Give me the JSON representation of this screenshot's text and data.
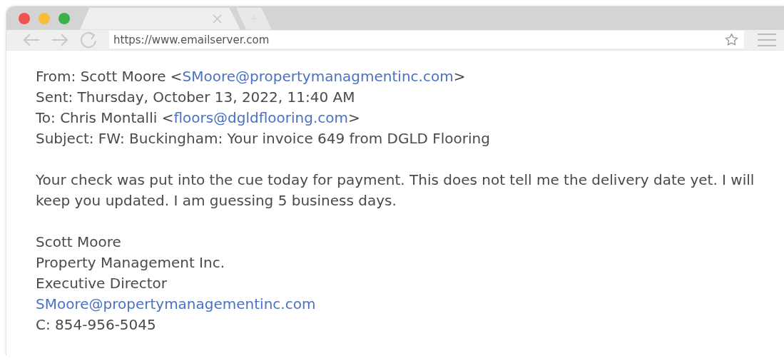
{
  "browser": {
    "tabs": [
      {
        "selected": true
      }
    ],
    "address": {
      "value": "https://www.emailserver.com"
    }
  },
  "email": {
    "header": [
      {
        "label": "From: Scott Moore <",
        "email": "SMoore@propertymanagmentinc.com",
        "after": ">"
      },
      {
        "label": "Sent: Thursday, October 13, 2022, 11:40 AM"
      },
      {
        "label": "To: Chris Montalli <",
        "email": "floors@dgldflooring.com",
        "after": ">"
      },
      {
        "label": "Subject: FW: Buckingham: Your invoice 649 from DGLD Flooring"
      }
    ],
    "body": "Your check was put into the cue today for payment. This does not tell me the delivery date yet. I will keep you updated. I am guessing 5 business days.",
    "signature": [
      {
        "kind": "text",
        "text": "Scott Moore"
      },
      {
        "kind": "text",
        "text": "Property Management Inc."
      },
      {
        "kind": "text",
        "text": "Executive Director"
      },
      {
        "kind": "link",
        "text": "SMoore@propertymanagementinc.com"
      },
      {
        "kind": "text",
        "text": "C: 854-956-5045"
      }
    ]
  }
}
